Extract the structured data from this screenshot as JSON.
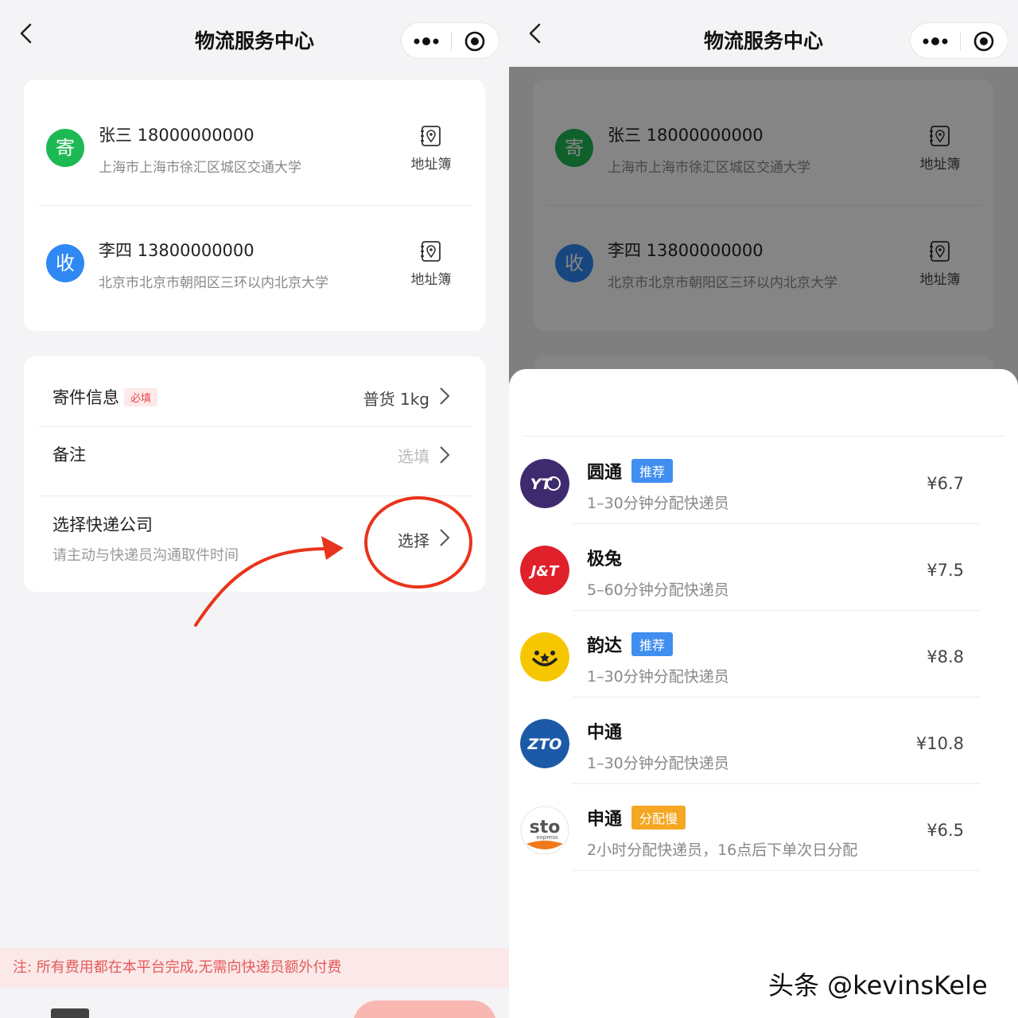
{
  "nav": {
    "title": "物流服务中心"
  },
  "sender": {
    "avatar": "寄",
    "name": "张三 18000000000",
    "address": "上海市上海市徐汇区城区交通大学",
    "book_label": "地址簿"
  },
  "receiver": {
    "avatar": "收",
    "name": "李四 13800000000",
    "address": "北京市北京市朝阳区三环以内北京大学",
    "book_label": "地址簿"
  },
  "info": {
    "shipment_label": "寄件信息",
    "required_badge": "必填",
    "shipment_value": "普货 1kg",
    "remark_label": "备注",
    "remark_value": "选填",
    "courier_label": "选择快递公司",
    "courier_hint": "请主动与快递员沟通取件时间",
    "courier_value": "选择"
  },
  "notice": "注: 所有费用都在本平台完成,无需向快递员额外付费",
  "couriers": [
    {
      "name": "圆通",
      "tag": "推荐",
      "tag_color": "#3f8ef0",
      "desc": "1–30分钟分配快递员",
      "price": "¥6.7",
      "logo_color": "#3e2a6e"
    },
    {
      "name": "极兔",
      "tag": "",
      "tag_color": "",
      "desc": "5–60分钟分配快递员",
      "price": "¥7.5",
      "logo_color": "#e0202a"
    },
    {
      "name": "韵达",
      "tag": "推荐",
      "tag_color": "#3f8ef0",
      "desc": "1–30分钟分配快递员",
      "price": "¥8.8",
      "logo_color": "#f6c700"
    },
    {
      "name": "中通",
      "tag": "",
      "tag_color": "",
      "desc": "1–30分钟分配快递员",
      "price": "¥10.8",
      "logo_color": "#1c5aa8"
    },
    {
      "name": "申通",
      "tag": "分配慢",
      "tag_color": "#f5a623",
      "desc": "2小时分配快递员，16点后下单次日分配",
      "price": "¥6.5",
      "logo_color": "#ffffff"
    }
  ],
  "logos": {
    "yto": "YT",
    "jt": "J&T",
    "zto": "ZTO",
    "sto": "sto",
    "sto_sub": "express"
  },
  "watermark": "头条 @kevinsKele",
  "colors": {
    "accent_red": "#e8341c",
    "green": "#1db953",
    "blue": "#2f88f3"
  }
}
